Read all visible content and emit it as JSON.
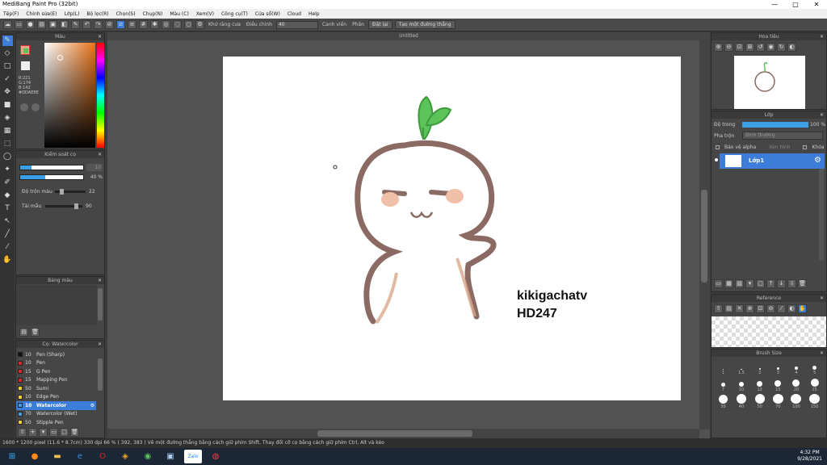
{
  "window": {
    "title": "MediBang Paint Pro (32bit)",
    "controls": [
      "—",
      "□",
      "✕"
    ]
  },
  "menu": [
    "Tệp(F)",
    "Chỉnh sửa(E)",
    "Lớp(L)",
    "Bộ lọc(R)",
    "Chọn(S)",
    "Chụp(N)",
    "Màu (C)",
    "Xem(V)",
    "Công cụ(T)",
    "Cửa sổ(W)",
    "Cloud",
    "Help"
  ],
  "toolbar": {
    "anti_alias": "Khử răng cưa",
    "adjust_label": "Điều chỉnh",
    "adjust_value": "40",
    "edge_label": "Canh viền",
    "fit_label": "Phân",
    "fit_btn": "Đặt lại",
    "new_path_btn": "Tạo một đường thẳng"
  },
  "document": {
    "tab": "Untitled"
  },
  "color_panel": {
    "title": "Màu",
    "rgb": [
      "R:221",
      "G:174",
      "B:142"
    ],
    "hex": "#DDAE8E"
  },
  "brush_control": {
    "title": "Kiểm soát cọ",
    "size_value": "10",
    "opacity_value": "40 %",
    "blend_label": "Độ trộn màu",
    "blend_value": "22",
    "density_label": "Tải mẫu",
    "density_value": "90"
  },
  "palette_panel": {
    "title": "Bảng màu"
  },
  "brush_list": {
    "title": "Cọ: Watercolor",
    "items": [
      {
        "size": "10",
        "name": "Pen (Sharp)",
        "color": "#111111"
      },
      {
        "size": "10",
        "name": "Pen",
        "color": "#d42a2a"
      },
      {
        "size": "15",
        "name": "G Pen",
        "color": "#d42a2a"
      },
      {
        "size": "15",
        "name": "Mapping Pen",
        "color": "#d42a2a"
      },
      {
        "size": "50",
        "name": "Sumi",
        "color": "#f0d020"
      },
      {
        "size": "10",
        "name": "Edge Pen",
        "color": "#f0d020"
      },
      {
        "size": "10",
        "name": "Watercolor",
        "color": "#3aa0e0"
      },
      {
        "size": "70",
        "name": "Watercolor (Wet)",
        "color": "#3aa0e0"
      },
      {
        "size": "50",
        "name": "Stipple Pen",
        "color": "#f0d020"
      }
    ]
  },
  "navigator": {
    "title": "Hoa tiêu"
  },
  "layer_panel": {
    "title": "Lớp",
    "opacity_label": "Độ trong",
    "opacity_value": "100 %",
    "blend_label": "Pha trộn",
    "blend_value": "Bình thường",
    "protect_alpha": "Bảo vệ alpha",
    "clipping": "Xén hình",
    "lock": "Khóa",
    "layer_name": "Lớp1"
  },
  "reference": {
    "title": "Reference"
  },
  "brush_size": {
    "title": "Brush Size",
    "sizes": [
      "1",
      "1.5",
      "2",
      "3",
      "4",
      "5",
      "7",
      "10",
      "12",
      "15",
      "20",
      "25",
      "30",
      "40",
      "50",
      "70",
      "100",
      "150"
    ]
  },
  "canvas_text": {
    "line1": "kikigachatv",
    "line2": "HD247"
  },
  "status": {
    "text": "1600 * 1200 pixel  (11.6 * 8.7cm)  330 dpi  66 %  ( 392, 383 )  Vẽ một đường thẳng bằng cách giữ phím Shift, Thay đổi cỡ cọ bằng cách giữ phím Ctrl, Alt và kéo"
  },
  "clock": {
    "time": "4:32 PM",
    "date": "9/28/2021"
  },
  "colors": {
    "accent": "#3b7dd8",
    "fg_color": "#DDAE8E",
    "sprout": "#5cc25a",
    "outline": "#8a6a62",
    "cheek": "#f0c0a8"
  }
}
